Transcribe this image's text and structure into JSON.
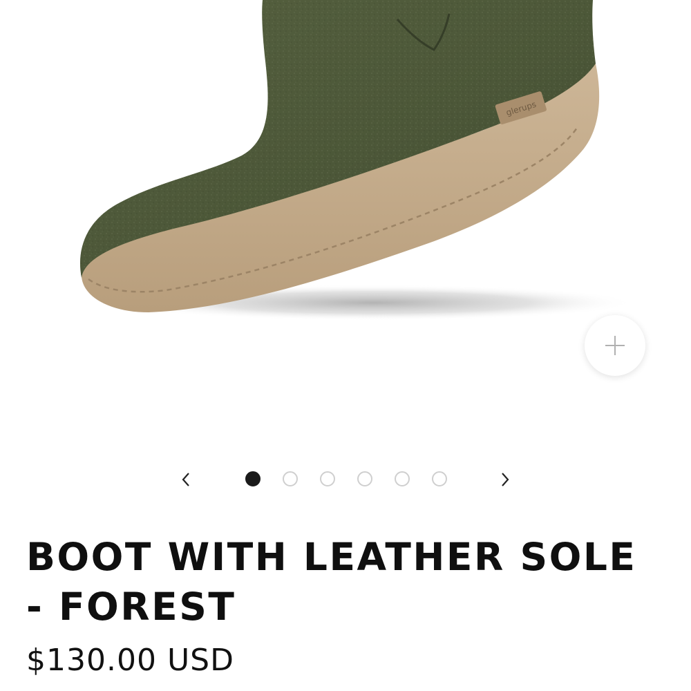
{
  "product": {
    "title": "BOOT WITH LEATHER SOLE - FOREST",
    "price": "$130.00 USD",
    "brand_tag": "glerups"
  },
  "gallery": {
    "image_count": 6,
    "active_index": 0,
    "prev_icon": "chevron-left-icon",
    "next_icon": "chevron-right-icon",
    "zoom_icon": "plus-icon"
  },
  "colors": {
    "felt": "#4f5a3c",
    "sole": "#c4ac8c",
    "active_dot": "#1a1a1a",
    "inactive_dot_border": "#cfcfcf",
    "text": "#111111"
  }
}
